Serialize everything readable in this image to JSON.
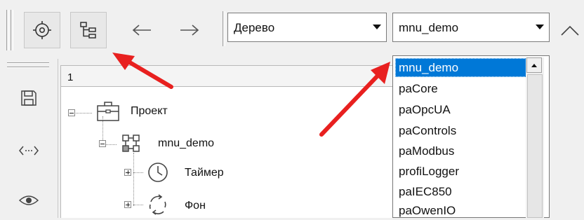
{
  "toolbar": {
    "view_combo": {
      "value": "Дерево"
    },
    "project_combo": {
      "value": "mnu_demo"
    }
  },
  "tree": {
    "header": "1",
    "nodes": [
      {
        "label": "Проект",
        "icon": "briefcase-icon",
        "expander": "minus"
      },
      {
        "label": "mnu_demo",
        "icon": "network-nodes-icon",
        "expander": "minus"
      },
      {
        "label": "Таймер",
        "icon": "clock-icon",
        "expander": "plus"
      },
      {
        "label": "Фон",
        "icon": "cycle-arrows-icon",
        "expander": "plus"
      }
    ]
  },
  "dropdown": {
    "selected": "mnu_demo",
    "items": [
      "mnu_demo",
      "paCore",
      "paOpcUA",
      "paControls",
      "paModbus",
      "profiLogger",
      "paIEC850",
      "paOwenIO"
    ]
  },
  "colors": {
    "selection": "#0078d7",
    "annotation_arrow": "#e8201f"
  }
}
